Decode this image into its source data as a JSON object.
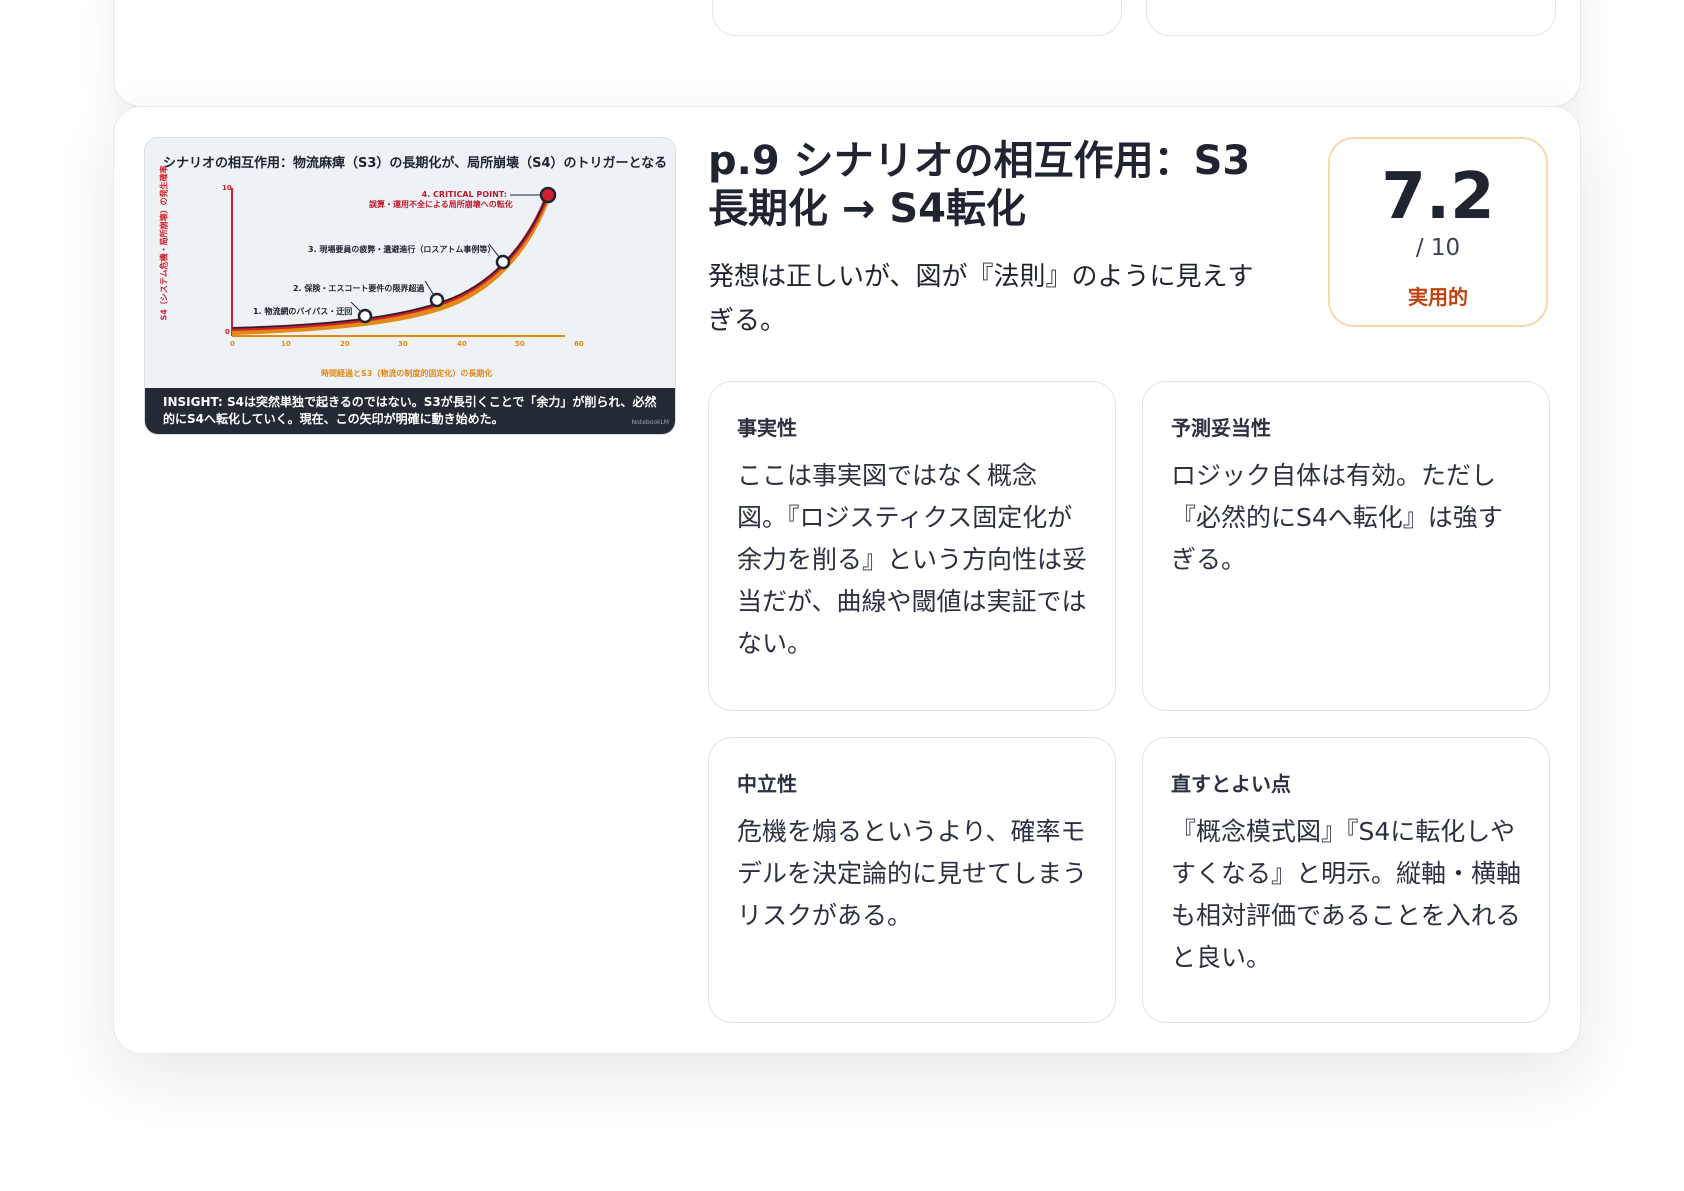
{
  "slide": {
    "page_label": "p.9",
    "title": "p.9 シナリオの相互作用：S3長期化 → S4転化",
    "summary": "発想は正しいが、図が『法則』のように見えすぎる。",
    "score": {
      "value": "7.2",
      "max": "/ 10",
      "tag": "実用的",
      "tag_color": "#c2410c"
    },
    "thumbnail": {
      "title": "シナリオの相互作用：物流麻痺（S3）の長期化が、局所崩壊（S4）のトリガーとなる",
      "y_axis_label": "S4（システム危機・局所崩壊）の発生確率",
      "x_axis_label": "時間経過とS3（物流の制度的固定化）の長期化",
      "y_ticks": [
        "10",
        "0"
      ],
      "x_ticks": [
        "0",
        "10",
        "20",
        "30",
        "40",
        "50",
        "60"
      ],
      "points": [
        {
          "label": "1. 物流網のバイパス・迂回"
        },
        {
          "label": "2. 保険・エスコート要件の限界超過"
        },
        {
          "label": "3. 現場要員の疲弊・遺避進行（ロスアトム事例等）"
        },
        {
          "label_line1": "4. CRITICAL POINT:",
          "label_line2": "誤算・運用不全による局所崩壊への転化"
        }
      ],
      "insight": "INSIGHT: S4は突然単独で起きるのではない。S3が長引くことで「余力」が削られ、必然的にS4へ転化していく。現在、この矢印が明確に動き始めた。",
      "watermark": "NotebookLM",
      "colors": {
        "curve": "#d2202e",
        "baseline": "#e38a14",
        "insight_bg": "#232a33"
      }
    },
    "criteria": [
      {
        "heading": "事実性",
        "body": "ここは事実図ではなく概念図。『ロジスティクス固定化が余力を削る』という方向性は妥当だが、曲線や閾値は実証ではない。"
      },
      {
        "heading": "予測妥当性",
        "body": "ロジック自体は有効。ただし『必然的にS4へ転化』は強すぎる。"
      },
      {
        "heading": "中立性",
        "body": "危機を煽るというより、確率モデルを決定論的に見せてしまうリスクがある。"
      },
      {
        "heading": "直すとよい点",
        "body": "『概念模式図』『S4に転化しやすくなる』と明示。縦軸・横軸も相対評価であることを入れると良い。"
      }
    ]
  }
}
